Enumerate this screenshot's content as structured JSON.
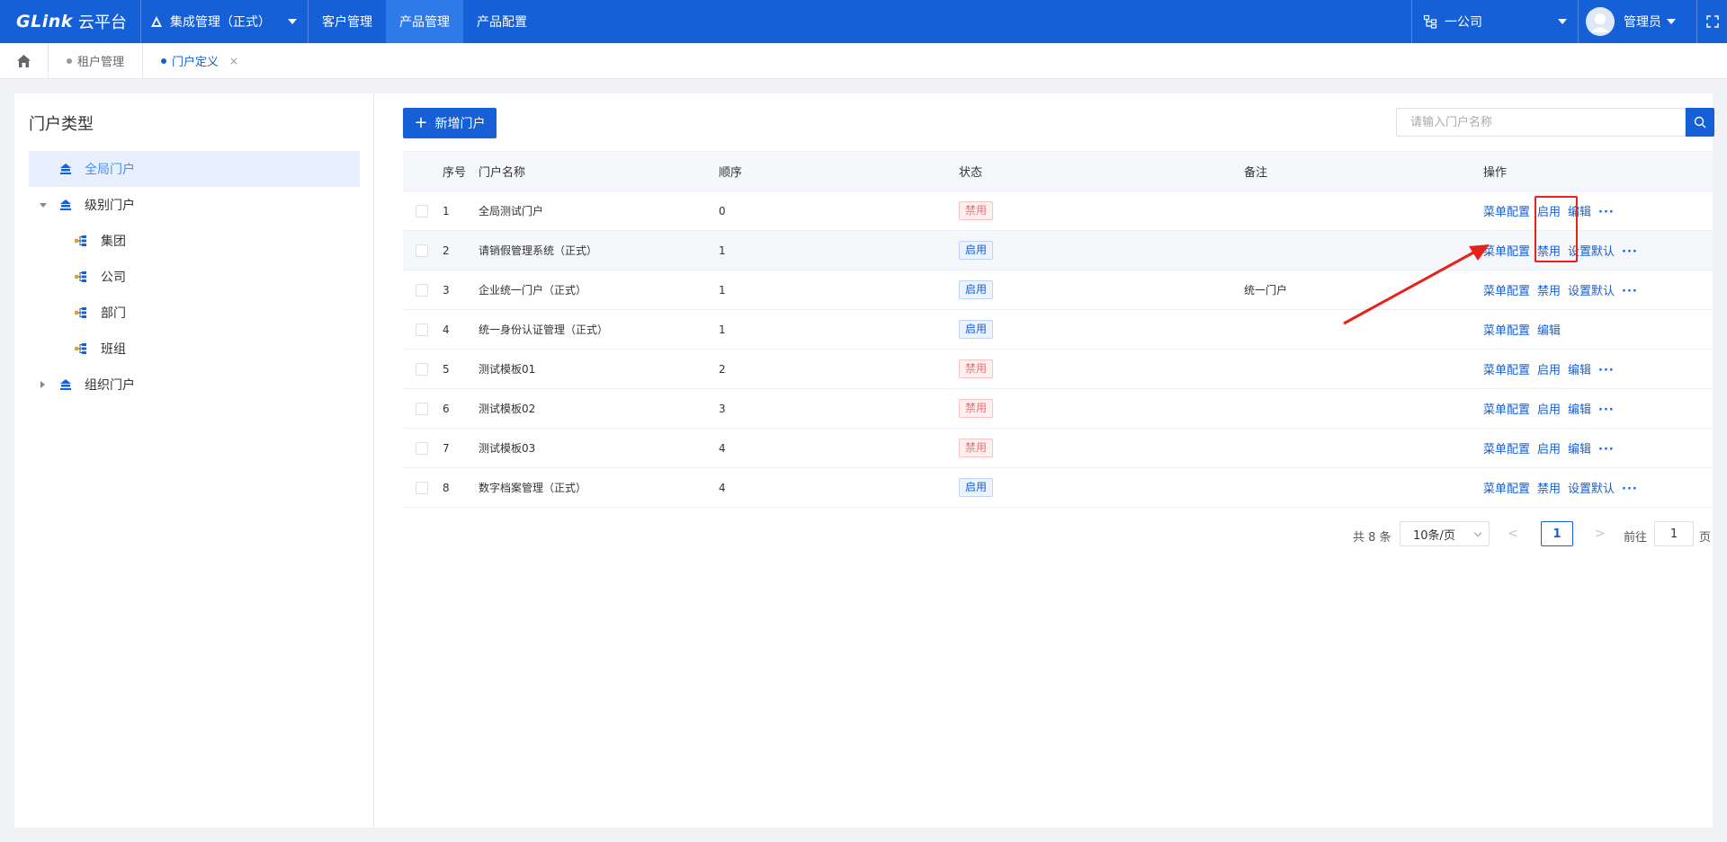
{
  "brand": {
    "logo_text": "GLink",
    "cloud_text": "云平台"
  },
  "app_select": {
    "label": "集成管理（正式）"
  },
  "nav": [
    {
      "label": "客户管理",
      "active": false
    },
    {
      "label": "产品管理",
      "active": true
    },
    {
      "label": "产品配置",
      "active": false
    }
  ],
  "company_select": {
    "label": "一公司"
  },
  "user": {
    "name": "管理员"
  },
  "tabs": [
    {
      "label": "租户管理",
      "active": false
    },
    {
      "label": "门户定义",
      "active": true,
      "close": "×"
    }
  ],
  "left_panel": {
    "title": "门户类型",
    "tree": [
      {
        "label": "全局门户",
        "level": 0,
        "selected": true,
        "expand": "none"
      },
      {
        "label": "级别门户",
        "level": 0,
        "selected": false,
        "expand": "expanded"
      },
      {
        "label": "集团",
        "level": 1,
        "selected": false,
        "expand": "none"
      },
      {
        "label": "公司",
        "level": 1,
        "selected": false,
        "expand": "none"
      },
      {
        "label": "部门",
        "level": 1,
        "selected": false,
        "expand": "none"
      },
      {
        "label": "班组",
        "level": 1,
        "selected": false,
        "expand": "none"
      },
      {
        "label": "组织门户",
        "level": 0,
        "selected": false,
        "expand": "collapsed"
      }
    ]
  },
  "toolbar": {
    "add_label": "新增门户",
    "search_placeholder": "请输入门户名称"
  },
  "table": {
    "columns": [
      "序号",
      "门户名称",
      "顺序",
      "状态",
      "备注",
      "操作"
    ],
    "rows": [
      {
        "no": "1",
        "name": "全局测试门户",
        "order": "0",
        "status": "禁用",
        "status_type": "off",
        "remark": "",
        "actions": [
          "菜单配置",
          "启用",
          "编辑"
        ],
        "more": "···"
      },
      {
        "no": "2",
        "name": "请销假管理系统（正式）",
        "order": "1",
        "status": "启用",
        "status_type": "on",
        "remark": "",
        "actions": [
          "菜单配置",
          "禁用",
          "设置默认"
        ],
        "more": "···"
      },
      {
        "no": "3",
        "name": "企业统一门户（正式）",
        "order": "1",
        "status": "启用",
        "status_type": "on",
        "remark": "统一门户",
        "actions": [
          "菜单配置",
          "禁用",
          "设置默认"
        ],
        "more": "···"
      },
      {
        "no": "4",
        "name": "统一身份认证管理（正式）",
        "order": "1",
        "status": "启用",
        "status_type": "on",
        "remark": "",
        "actions": [
          "菜单配置",
          "编辑"
        ],
        "more": ""
      },
      {
        "no": "5",
        "name": "测试模板01",
        "order": "2",
        "status": "禁用",
        "status_type": "off",
        "remark": "",
        "actions": [
          "菜单配置",
          "启用",
          "编辑"
        ],
        "more": "···"
      },
      {
        "no": "6",
        "name": "测试模板02",
        "order": "3",
        "status": "禁用",
        "status_type": "off",
        "remark": "",
        "actions": [
          "菜单配置",
          "启用",
          "编辑"
        ],
        "more": "···"
      },
      {
        "no": "7",
        "name": "测试模板03",
        "order": "4",
        "status": "禁用",
        "status_type": "off",
        "remark": "",
        "actions": [
          "菜单配置",
          "启用",
          "编辑"
        ],
        "more": "···"
      },
      {
        "no": "8",
        "name": "数字档案管理（正式）",
        "order": "4",
        "status": "启用",
        "status_type": "on",
        "remark": "",
        "actions": [
          "菜单配置",
          "禁用",
          "设置默认"
        ],
        "more": "···"
      }
    ]
  },
  "pagination": {
    "total": "共 8 条",
    "page_size": "10条/页",
    "prev": "<",
    "current": "1",
    "next": ">",
    "goto_label": "前往",
    "goto_value": "1",
    "page_unit": "页"
  },
  "colors": {
    "primary": "#1560d6",
    "danger": "#f56c6c",
    "annotation": "#e5231b"
  },
  "icons": [
    "triangle-logo-icon",
    "caret-down-icon",
    "org-tree-icon",
    "fullscreen-icon",
    "home-icon",
    "portal-icon",
    "branch-node-icon",
    "search-icon",
    "plus-icon"
  ]
}
